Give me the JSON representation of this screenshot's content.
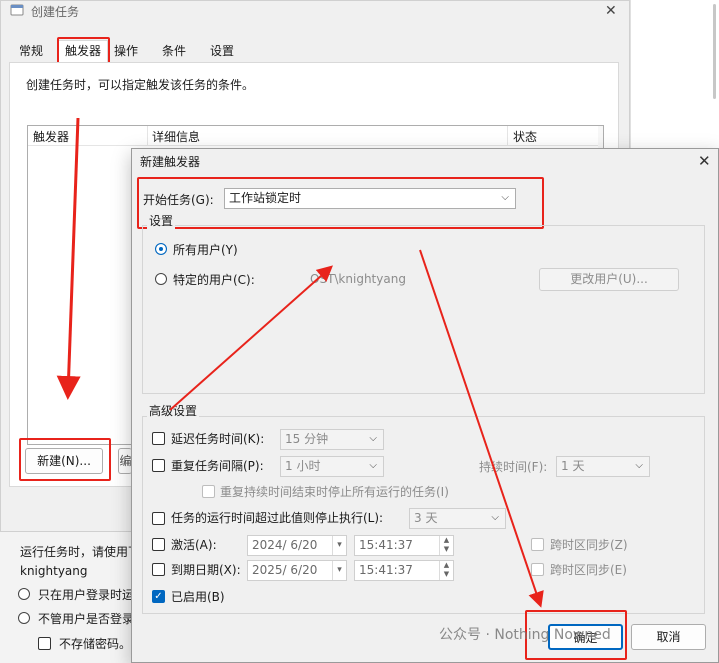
{
  "bg_window": {
    "title": "创建任务",
    "tabs": [
      {
        "label": "常规"
      },
      {
        "label": "触发器"
      },
      {
        "label": "操作"
      },
      {
        "label": "条件"
      },
      {
        "label": "设置"
      }
    ],
    "description": "创建任务时，可以指定触发该任务的条件。",
    "columns": {
      "trigger": "触发器",
      "details": "详细信息",
      "status": "状态"
    },
    "new_button": "新建(N)...",
    "partial_button": "编",
    "run_as_text": "运行任务时，请使用下",
    "user_name": "knightyang",
    "option_logged_on": "只在用户登录时运",
    "option_whether": "不管用户是否登录",
    "option_no_store": "不存储密码。"
  },
  "dialog": {
    "title": "新建触发器",
    "begin_task_label": "开始任务(G):",
    "begin_task_value": "工作站锁定时",
    "settings_legend": "设置",
    "all_users_label": "所有用户(Y)",
    "specific_user_label": "特定的用户(C):",
    "specific_user_value": "OST\\knightyang",
    "change_user_button": "更改用户(U)...",
    "advanced_legend": "高级设置",
    "delay_label": "延迟任务时间(K):",
    "delay_value": "15 分钟",
    "repeat_label": "重复任务间隔(P):",
    "repeat_value": "1 小时",
    "duration_label": "持续时间(F):",
    "duration_value": "1 天",
    "stop_all_label": "重复持续时间结束时停止所有运行的任务(I)",
    "stop_longer_label": "任务的运行时间超过此值则停止执行(L):",
    "stop_longer_value": "3 天",
    "activate_label": "激活(A):",
    "activate_date": "2024/ 6/20",
    "activate_time": "15:41:37",
    "expire_label": "到期日期(X):",
    "expire_date": "2025/ 6/20",
    "expire_time": "15:41:37",
    "sync_tz_1": "跨时区同步(Z)",
    "sync_tz_2": "跨时区同步(E)",
    "enabled_label": "已启用(B)",
    "ok_button": "确定",
    "cancel_button": "取消"
  },
  "watermark": "公众号 · Nothing Nowned",
  "colors": {
    "annotation_red": "#e8231b",
    "accent_blue": "#0067c0"
  }
}
